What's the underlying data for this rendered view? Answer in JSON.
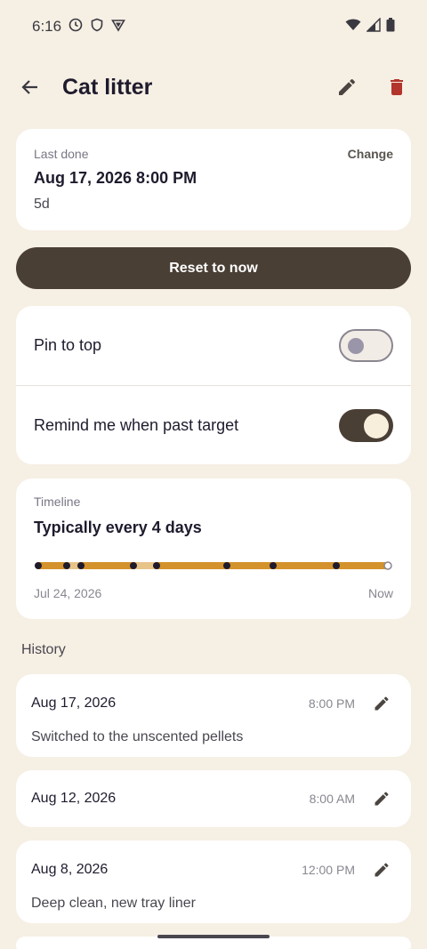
{
  "status_bar": {
    "time": "6:16"
  },
  "app_bar": {
    "title": "Cat litter"
  },
  "last_done": {
    "label": "Last done",
    "change_label": "Change",
    "datetime": "Aug 17, 2026 8:00 PM",
    "elapsed": "5d"
  },
  "reset_label": "Reset to now",
  "toggles": {
    "pin": {
      "label": "Pin to top",
      "checked": false
    },
    "remind": {
      "label": "Remind me when past target",
      "checked": true
    }
  },
  "timeline": {
    "label": "Timeline",
    "summary": "Typically every 4 days",
    "start_label": "Jul 24, 2026",
    "end_label": "Now"
  },
  "history": {
    "heading": "History",
    "entries": [
      {
        "date": "Aug 17, 2026",
        "time": "8:00 PM",
        "note": "Switched to the unscented pellets"
      },
      {
        "date": "Aug 12, 2026",
        "time": "8:00 AM",
        "note": ""
      },
      {
        "date": "Aug 8, 2026",
        "time": "12:00 PM",
        "note": "Deep clean, new tray liner"
      }
    ]
  },
  "colors": {
    "background": "#f6efe4",
    "primary_dark": "#4a3f35",
    "delete_red": "#b3342b",
    "timeline_accent": "#d4922c"
  }
}
